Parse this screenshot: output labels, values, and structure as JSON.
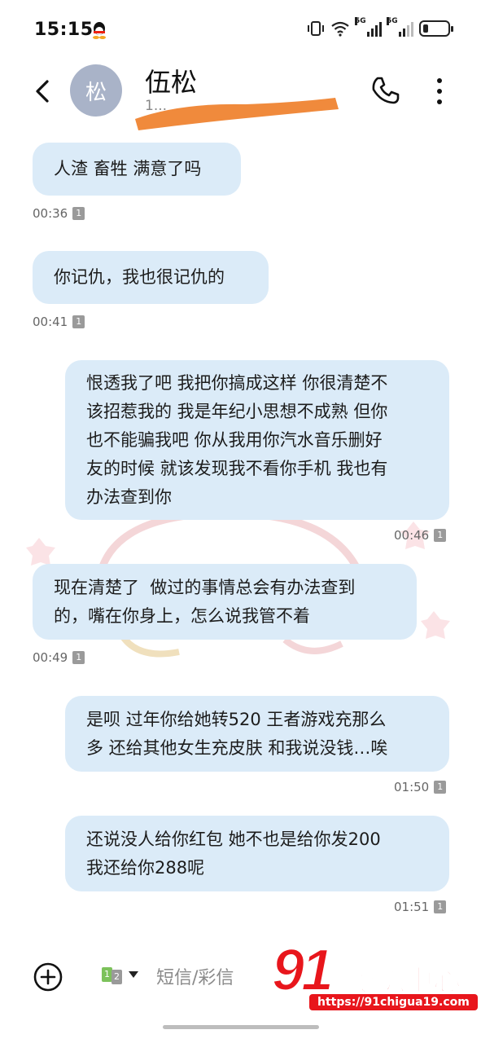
{
  "status_bar": {
    "time": "15:15",
    "network_1": "5G",
    "network_2": "5G",
    "battery_level": 0.2
  },
  "header": {
    "avatar_letter": "松",
    "contact_name": "伍松",
    "contact_number_partial": "1...",
    "back_icon": "chevron-left-icon",
    "call_icon": "phone-icon",
    "more_icon": "more-vertical-icon"
  },
  "messages": [
    {
      "direction": "received",
      "lines": [
        "人渣 畜牲 满意了吗"
      ],
      "time": "00:36",
      "sim": "1"
    },
    {
      "direction": "received",
      "lines": [
        "你记仇，我也很记仇的"
      ],
      "time": "00:41",
      "sim": "1"
    },
    {
      "direction": "sent",
      "lines": [
        "恨透我了吧 我把你搞成这样 你很清楚不",
        "该招惹我的 我是年纪小思想不成熟 但你",
        "也不能骗我吧 你从我用你汽水音乐删好",
        "友的时候 就该发现我不看你手机 我也有",
        "办法查到你"
      ],
      "time": "00:46",
      "sim": "1"
    },
    {
      "direction": "received",
      "lines": [
        "现在清楚了  做过的事情总会有办法查到",
        "的，嘴在你身上，怎么说我管不着"
      ],
      "time": "00:49",
      "sim": "1"
    },
    {
      "direction": "sent",
      "lines": [
        "是呗 过年你给她转520 王者游戏充那么",
        "多 还给其他女生充皮肤 和我说没钱…唉"
      ],
      "time": "01:50",
      "sim": "1"
    },
    {
      "direction": "sent",
      "lines": [
        "还说没人给你红包 她不也是给你发200",
        "我还给你288呢"
      ],
      "time": "01:51",
      "sim": "1"
    }
  ],
  "compose": {
    "placeholder": "短信/彩信",
    "sim_primary": "1",
    "sim_secondary": "2",
    "add_icon": "plus-circle-icon"
  },
  "watermark": {
    "number": "91",
    "text": "吃瓜中心",
    "url": "https://91chigua19.com"
  }
}
